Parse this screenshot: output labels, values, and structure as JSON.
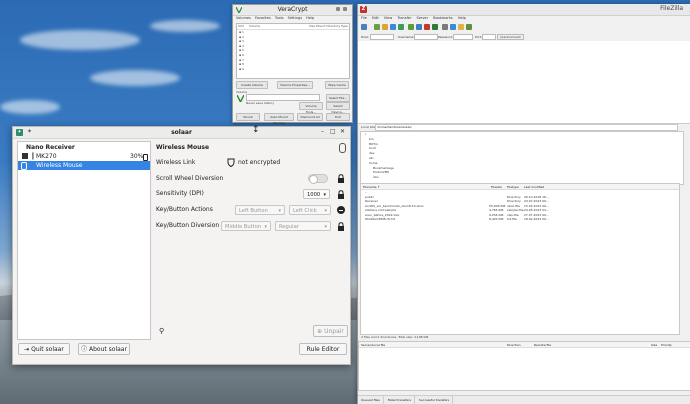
{
  "veracrypt": {
    "title": "VeraCrypt",
    "menu": [
      "Volumes",
      "Favorites",
      "Tools",
      "Settings",
      "Help"
    ],
    "list_headers": [
      "Slot",
      "Volume",
      "Size",
      "Mount Directory",
      "Type"
    ],
    "slots": [
      "1",
      "2",
      "3",
      "4",
      "5",
      "6",
      "7",
      "8",
      "9"
    ],
    "buttons": {
      "create": "Create Volume",
      "props": "Volume Properties...",
      "wipe": "Wipe Cache",
      "select_file": "Select File...",
      "volume_tools": "Volume Tools...",
      "select_device": "Select Device...",
      "mount": "Mount",
      "auto_mount": "Auto-Mount Devices",
      "dismount_all": "Dismount All",
      "exit": "Exit"
    },
    "volume_label": "Volume",
    "never_save": "Never save history"
  },
  "filezilla": {
    "title": "FileZilla",
    "menu": [
      "File",
      "Edit",
      "View",
      "Transfer",
      "Server",
      "Bookmarks",
      "Help"
    ],
    "quickconnect": {
      "host": "Host:",
      "username": "Username:",
      "password": "Password:",
      "port": "Port:",
      "button": "Quickconnect"
    },
    "local_site_label": "Local site:",
    "local_site": "/home/dan/Downloads/",
    "tree": [
      "/",
      "bin",
      "BOT/u",
      "boot",
      "dev",
      "etc",
      "home",
      "Bookmarkage",
      "ProtonVPN",
      "dan",
      "• .cache",
      "autostart.desk"
    ],
    "file_headers": [
      "Filename ↑",
      "Filesize",
      "Filetype",
      "Last modified"
    ],
    "files": [
      {
        "name": "..",
        "size": "",
        "type": "",
        "modified": ""
      },
      {
        "name": "public",
        "size": "",
        "type": "Directory",
        "modified": "26.10.2018 16..."
      },
      {
        "name": "Receiver",
        "size": "",
        "type": "Directory",
        "modified": "24.07.2023 09..."
      },
      {
        "name": "AndOS_vm_benchmark_ubu18.10.vbox",
        "size": "55,006 KiB",
        "type": "vbox-file",
        "modified": "15.03.2023 09..."
      },
      {
        "name": "stations.conf.sample",
        "size": "4,765 KiB",
        "type": "sample-file",
        "modified": "24.05.2023 04..."
      },
      {
        "name": "soon_before_2019.xlsx",
        "size": "9,254 KiB",
        "type": "xlsx-file",
        "modified": "27.07.2023 09..."
      },
      {
        "name": "WinDbxCDM8.ctl.txt",
        "size": "8,420 KiB",
        "type": "txt-file",
        "modified": "18.02.2023 09..."
      }
    ],
    "local_status": "4 files and 2 directories. Total size: 4,198 KiB",
    "queue_headers": [
      "Server/Local file",
      "Direction",
      "Remote file",
      "Size",
      "Priority"
    ],
    "queue_tabs": [
      "Queued files",
      "Failed transfers",
      "Successful transfers"
    ]
  },
  "solaar": {
    "title": "solaar",
    "receiver": "Nano Receiver",
    "devices": [
      {
        "name": "MK270",
        "battery": "30%"
      },
      {
        "name": "Wireless Mouse",
        "battery": ""
      }
    ],
    "detail_title": "Wireless Mouse",
    "wireless_link_label": "Wireless Link",
    "wireless_link_value": "not encrypted",
    "scroll_label": "Scroll Wheel Diversion",
    "dpi_label": "Sensitivity (DPI)",
    "dpi_value": "1000",
    "key_actions_label": "Key/Button Actions",
    "key_actions_a": "Left Button",
    "key_actions_b": "Left Click",
    "key_diversion_label": "Key/Button Diversion",
    "key_diversion_a": "Middle Button",
    "key_diversion_b": "Regular",
    "unpair": "Unpair",
    "quit": "Quit solaar",
    "about": "About solaar",
    "rule_editor": "Rule Editor"
  }
}
